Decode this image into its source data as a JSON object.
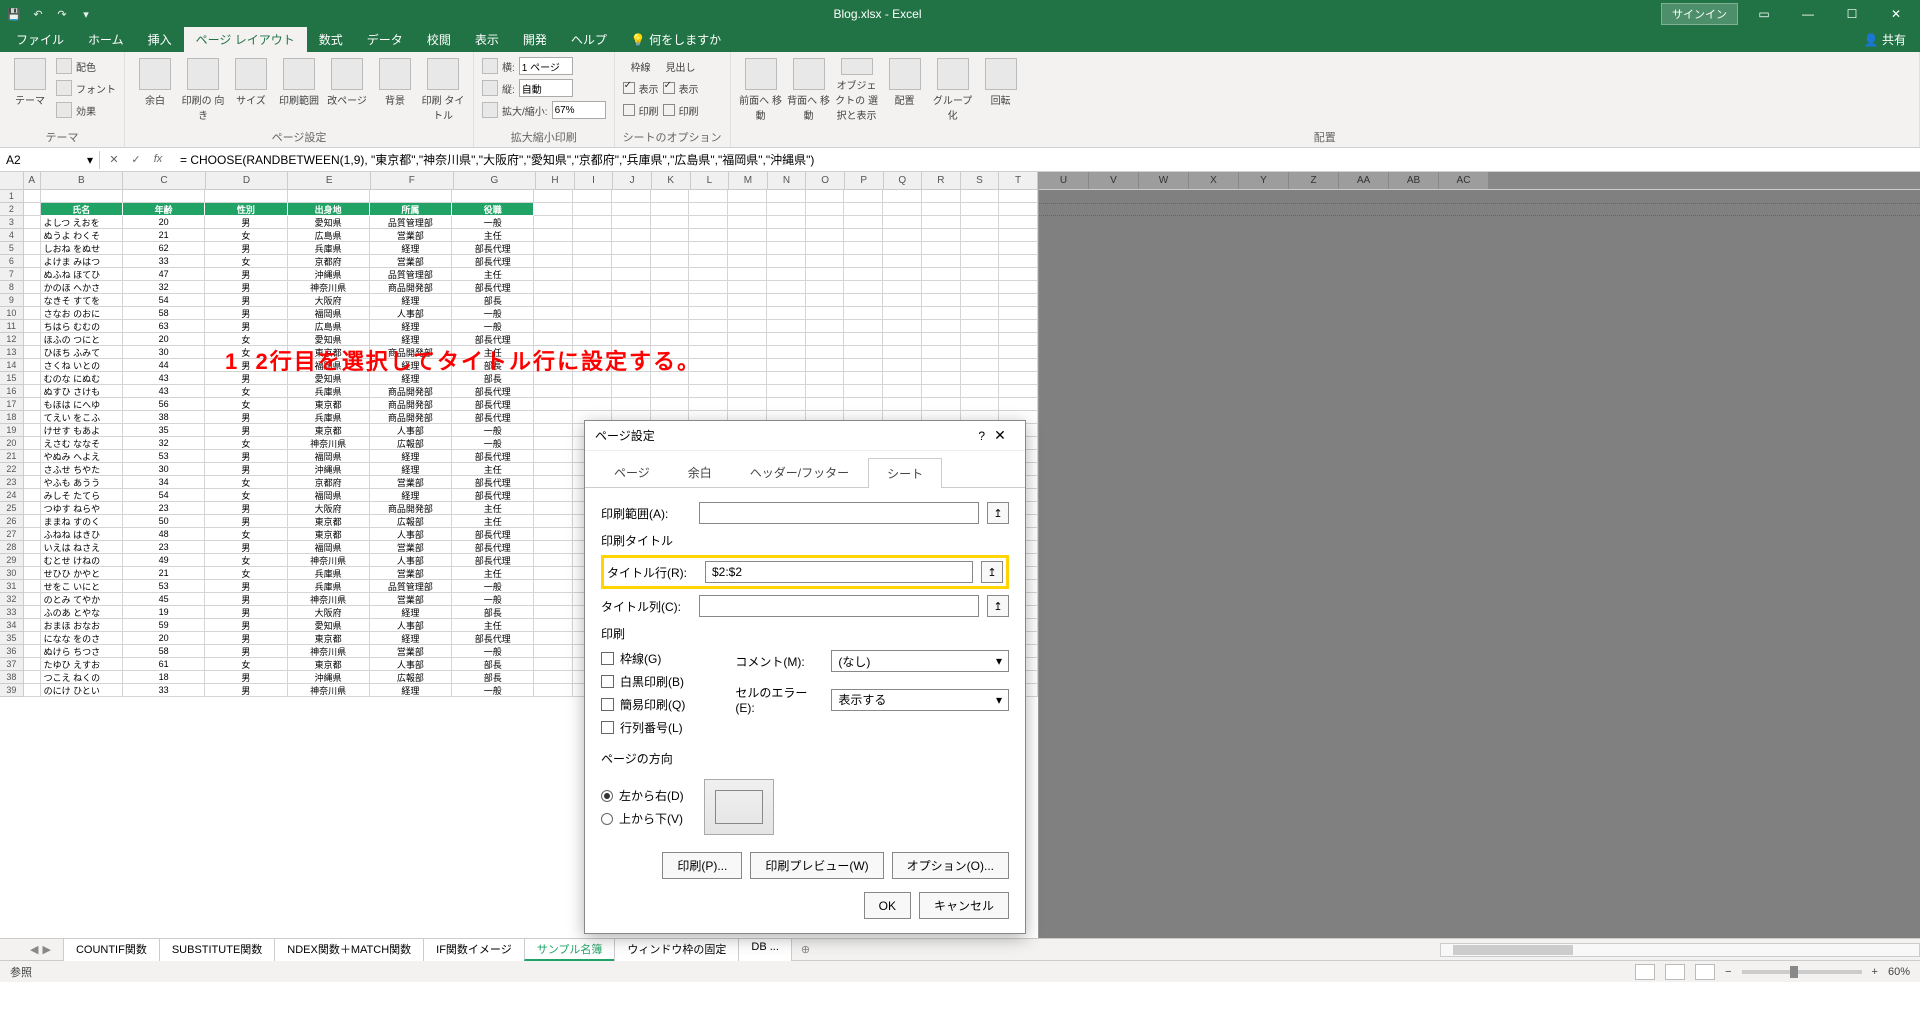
{
  "titlebar": {
    "title": "Blog.xlsx - Excel",
    "signin": "サインイン"
  },
  "ribbon_tabs": [
    "ファイル",
    "ホーム",
    "挿入",
    "ページ レイアウト",
    "数式",
    "データ",
    "校閲",
    "表示",
    "開発",
    "ヘルプ"
  ],
  "tell_me": "何をしますか",
  "share": "共有",
  "ribbon": {
    "themes": {
      "label": "テーマ",
      "colors": "配色",
      "fonts": "フォント",
      "effects": "効果"
    },
    "page_setup": {
      "label": "ページ設定",
      "margins": "余白",
      "orientation": "印刷の\n向き",
      "size": "サイズ",
      "print_area": "印刷範囲",
      "breaks": "改ページ",
      "background": "背景",
      "print_titles": "印刷\nタイトル"
    },
    "scale": {
      "label": "拡大縮小印刷",
      "width_lbl": "横:",
      "width_val": "1 ページ",
      "height_lbl": "縦:",
      "height_val": "自動",
      "scale_lbl": "拡大/縮小:",
      "scale_val": "67%"
    },
    "sheet_opts": {
      "label": "シートのオプション",
      "grid": "枠線",
      "head": "見出し",
      "show": "表示",
      "print": "印刷"
    },
    "arrange": {
      "label": "配置",
      "forward": "前面へ\n移動",
      "backward": "背面へ\n移動",
      "select": "オブジェクトの\n選択と表示",
      "align": "配置",
      "group": "グループ化",
      "rotate": "回転"
    }
  },
  "namebox": "A2",
  "formula": "= CHOOSE(RANDBETWEEN(1,9), \"東京都\",\"神奈川県\",\"大阪府\",\"愛知県\",\"京都府\",\"兵庫県\",\"広島県\",\"福岡県\",\"沖縄県\")",
  "columns_left": [
    "A",
    "B",
    "C",
    "D",
    "E",
    "F",
    "G",
    "H",
    "I",
    "J",
    "K",
    "L",
    "M",
    "N",
    "O",
    "P",
    "Q",
    "R",
    "S",
    "T"
  ],
  "columns_right": [
    "U",
    "V",
    "W",
    "X",
    "Y",
    "Z",
    "AA",
    "AB",
    "AC"
  ],
  "headers": [
    "氏名",
    "年齢",
    "性別",
    "出身地",
    "所属",
    "役職"
  ],
  "rows": [
    [
      "よしつ えおを",
      "20",
      "男",
      "愛知県",
      "品質管理部",
      "一般"
    ],
    [
      "ぬうよ わくそ",
      "21",
      "女",
      "広島県",
      "営業部",
      "主任"
    ],
    [
      "しおね をぬせ",
      "62",
      "男",
      "兵庫県",
      "経理",
      "部長代理"
    ],
    [
      "よけま みはつ",
      "33",
      "女",
      "京都府",
      "営業部",
      "部長代理"
    ],
    [
      "ぬふね ほてひ",
      "47",
      "男",
      "沖縄県",
      "品質管理部",
      "主任"
    ],
    [
      "かのほ へかさ",
      "32",
      "男",
      "神奈川県",
      "商品開発部",
      "部長代理"
    ],
    [
      "なきそ すてを",
      "54",
      "男",
      "大阪府",
      "経理",
      "部長"
    ],
    [
      "さなお のおに",
      "58",
      "男",
      "福岡県",
      "人事部",
      "一般"
    ],
    [
      "ちはら むむの",
      "63",
      "男",
      "広島県",
      "経理",
      "一般"
    ],
    [
      "ほふの つにと",
      "20",
      "女",
      "愛知県",
      "経理",
      "部長代理"
    ],
    [
      "ひほち ふみて",
      "30",
      "女",
      "東京都",
      "商品開発部",
      "主任"
    ],
    [
      "さくね いとの",
      "44",
      "男",
      "福岡県",
      "経理",
      "部長"
    ],
    [
      "むのな にぬむ",
      "43",
      "男",
      "愛知県",
      "経理",
      "部長"
    ],
    [
      "ぬすひ さけも",
      "43",
      "女",
      "兵庫県",
      "商品開発部",
      "部長代理"
    ],
    [
      "もほは にへゆ",
      "56",
      "女",
      "東京都",
      "商品開発部",
      "部長代理"
    ],
    [
      "てえい をこふ",
      "38",
      "男",
      "兵庫県",
      "商品開発部",
      "部長代理"
    ],
    [
      "けせす もあよ",
      "35",
      "男",
      "東京都",
      "人事部",
      "一般"
    ],
    [
      "えさむ ななそ",
      "32",
      "女",
      "神奈川県",
      "広報部",
      "一般"
    ],
    [
      "やぬみ へよえ",
      "53",
      "男",
      "福岡県",
      "経理",
      "部長代理"
    ],
    [
      "さふせ ちやた",
      "30",
      "男",
      "沖縄県",
      "経理",
      "主任"
    ],
    [
      "やふも あうう",
      "34",
      "女",
      "京都府",
      "営業部",
      "部長代理"
    ],
    [
      "みしそ たてら",
      "54",
      "女",
      "福岡県",
      "経理",
      "部長代理"
    ],
    [
      "つゆす ねらや",
      "23",
      "男",
      "大阪府",
      "商品開発部",
      "主任"
    ],
    [
      "ままね すのく",
      "50",
      "男",
      "東京都",
      "広報部",
      "主任"
    ],
    [
      "ふねね はきひ",
      "48",
      "女",
      "東京都",
      "人事部",
      "部長代理"
    ],
    [
      "いえは ねさえ",
      "23",
      "男",
      "福岡県",
      "営業部",
      "部長代理"
    ],
    [
      "むとせ けねの",
      "49",
      "女",
      "神奈川県",
      "人事部",
      "部長代理"
    ],
    [
      "せひひ かやと",
      "21",
      "女",
      "兵庫県",
      "営業部",
      "主任"
    ],
    [
      "せをこ いにと",
      "53",
      "男",
      "兵庫県",
      "品質管理部",
      "一般"
    ],
    [
      "のとみ てやか",
      "45",
      "男",
      "神奈川県",
      "営業部",
      "一般"
    ],
    [
      "ふのあ とやな",
      "19",
      "男",
      "大阪府",
      "経理",
      "部長"
    ],
    [
      "おまほ おなお",
      "59",
      "男",
      "愛知県",
      "人事部",
      "主任"
    ],
    [
      "になな をのさ",
      "20",
      "男",
      "東京都",
      "経理",
      "部長代理"
    ],
    [
      "ぬけら ちつさ",
      "58",
      "男",
      "神奈川県",
      "営業部",
      "一般"
    ],
    [
      "たゆひ えすお",
      "61",
      "女",
      "東京都",
      "人事部",
      "部長"
    ],
    [
      "つこえ ねくの",
      "18",
      "男",
      "沖縄県",
      "広報部",
      "部長"
    ],
    [
      "のにけ ひとい",
      "33",
      "男",
      "神奈川県",
      "経理",
      "一般"
    ]
  ],
  "annot_number": "1",
  "annotation": "2行目を選択してタイトル行に設定する。",
  "dialog": {
    "title": "ページ設定",
    "tabs": [
      "ページ",
      "余白",
      "ヘッダー/フッター",
      "シート"
    ],
    "active_tab": 3,
    "print_area_lbl": "印刷範囲(A):",
    "print_titles_lbl": "印刷タイトル",
    "title_row_lbl": "タイトル行(R):",
    "title_row_val": "$2:$2",
    "title_col_lbl": "タイトル列(C):",
    "print_section_lbl": "印刷",
    "opt_gridlines": "枠線(G)",
    "opt_bw": "白黒印刷(B)",
    "opt_draft": "簡易印刷(Q)",
    "opt_rowcol": "行列番号(L)",
    "comments_lbl": "コメント(M):",
    "comments_val": "(なし)",
    "errors_lbl": "セルのエラー(E):",
    "errors_val": "表示する",
    "pagedir_lbl": "ページの方向",
    "dir_lr": "左から右(D)",
    "dir_tb": "上から下(V)",
    "print_btn": "印刷(P)...",
    "preview_btn": "印刷プレビュー(W)",
    "options_btn": "オプション(O)...",
    "ok": "OK",
    "cancel": "キャンセル"
  },
  "sheet_tabs": [
    "COUNTIF関数",
    "SUBSTITUTE関数",
    "NDEX関数＋MATCH関数",
    "IF関数イメージ",
    "サンプル名簿",
    "ウィンドウ枠の固定",
    "DB  ..."
  ],
  "active_sheet_tab": 4,
  "statusbar": {
    "left": "参照",
    "zoom": "60%"
  }
}
